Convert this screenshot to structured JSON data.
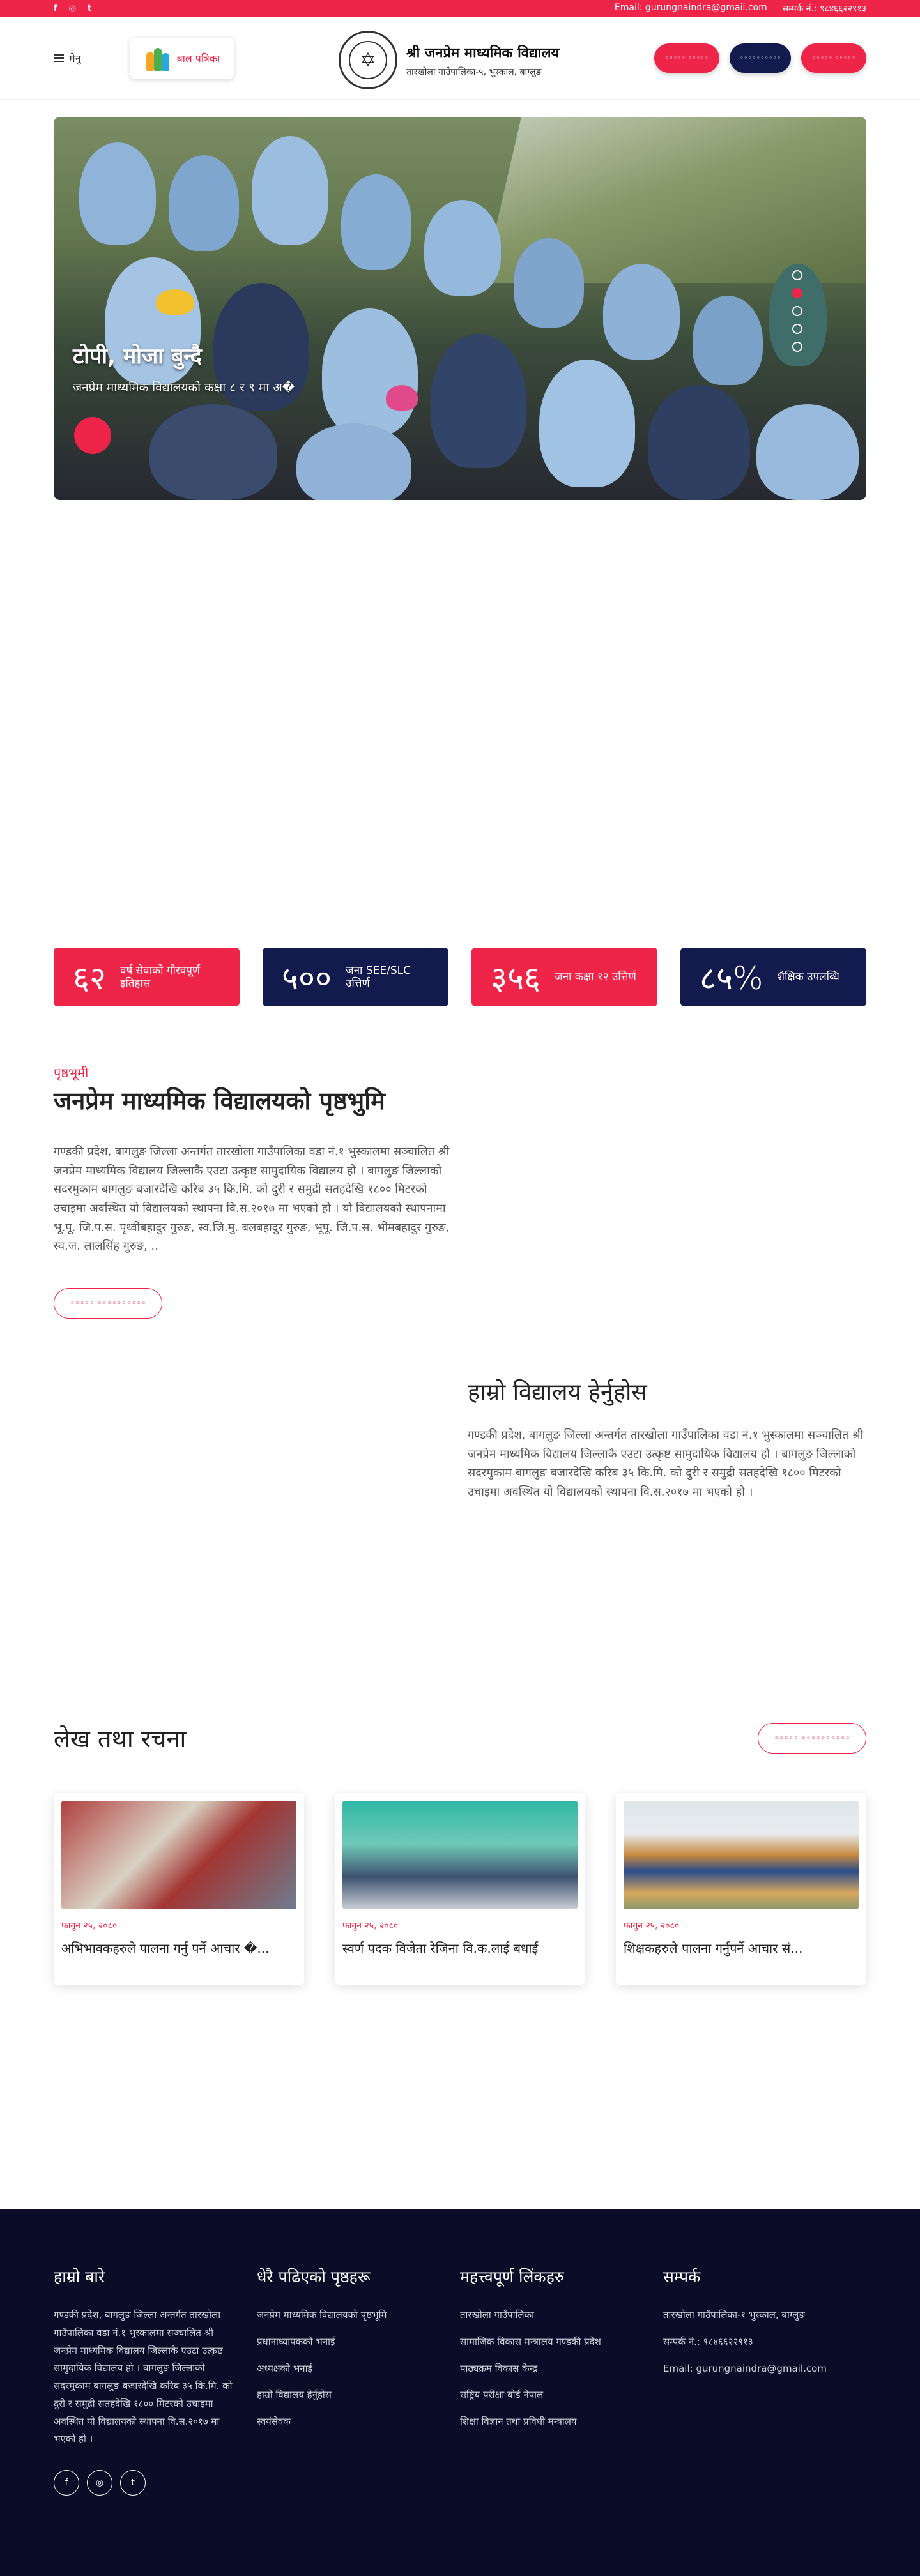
{
  "topbar": {
    "social": [
      "f",
      "◎",
      "t"
    ],
    "email": "Email: gurungnaindra@gmail.com",
    "phone": "सम्पर्क नं.: ९८४६६२२९१३"
  },
  "header": {
    "menu_label": "मेनु",
    "bal_label": "बाल पत्रिका",
    "school_name": "श्री जनप्रेम माध्यमिक विद्यालय",
    "school_address": "तारखोला गाउँपालिका-५, भुस्काल, बाग्लुङ",
    "buttons": [
      "◦◦◦◦◦ ◦◦◦◦◦",
      "◦◦◦◦◦◦◦◦◦◦",
      "◦◦◦◦◦ ◦◦◦◦◦"
    ]
  },
  "hero": {
    "title": "टोपी, मोजा बुन्दै",
    "subtitle": "जनप्रेम माध्यमिक विद्यालयको कक्षा ८ र ९ मा अ�",
    "slides": 5,
    "active_slide": 1
  },
  "stats": [
    {
      "num": "६२",
      "label": "वर्ष सेवाको गौरवपूर्ण इतिहास",
      "color": "red"
    },
    {
      "num": "५००",
      "label": "जना SEE/SLC उत्तिर्ण",
      "color": "navy"
    },
    {
      "num": "३५६",
      "label": "जना कक्षा १२ उत्तिर्ण",
      "color": "red"
    },
    {
      "num": "८५%",
      "label": "शैक्षिक उपलब्धि",
      "color": "navy"
    }
  ],
  "about": {
    "kicker": "पृष्ठभूमी",
    "title": "जनप्रेम माध्यमिक विद्यालयको पृष्ठभुमि",
    "text": "गण्डकी प्रदेश, बागलुङ जिल्ला अन्तर्गत तारखोला गाउँपालिका वडा नं.१ भुस्कालमा सञ्चालित श्री जनप्रेम माध्यमिक विद्यालय जिल्लाकै एउटा उत्कृष्ट सामुदायिक विद्यालय हो । बागलुङ जिल्लाको सदरमुकाम बागलुङ बजारदेखि करिब ३५ कि.मि. को दुरी र समुद्री सतहदेखि १८०० मिटरको उचाइमा अवस्थित यो विद्यालयको स्थापना वि.स.२०१७ मा भएको हो । यो विद्यालयको स्थापनामा भू.पू. जि.प.स. पृथ्वीबहादुर गुरुङ, स्व.जि.मु. बलबहादुर गुरुङ, भूपू. जि.प.स. भीमबहादुर गुरुङ, स्व.ज. लालसिंह गुरुङ, ..",
    "button": "◦◦◦◦◦ ◦◦◦◦◦◦◦◦◦◦"
  },
  "visit": {
    "title": "हाम्रो विद्यालय हेर्नुहोस",
    "text": "गण्डकी प्रदेश, बागलुङ जिल्ला अन्तर्गत तारखोला गाउँपालिका वडा नं.१ भुस्कालमा सञ्चालित श्री जनप्रेम माध्यमिक विद्यालय जिल्लाकै एउटा उत्कृष्ट सामुदायिक विद्यालय हो । बागलुङ जिल्लाको सदरमुकाम बागलुङ बजारदेखि करिब ३५ कि.मि. को दुरी र समुद्री सतहदेखि १८०० मिटरको उचाइमा अवस्थित यो विद्यालयको स्थापना वि.स.२०१७ मा भएको हो ।"
  },
  "articles": {
    "title": "लेख तथा रचना",
    "button": "◦◦◦◦◦ ◦◦◦◦◦◦◦◦◦◦",
    "items": [
      {
        "date": "फागुन २५, २०८०",
        "title": "अभिभावकहरुले पालना गर्नु पर्ने आचार �..."
      },
      {
        "date": "फागुन २५, २०८०",
        "title": "स्वर्ण पदक विजेता रेजिना वि.क.लाई बधाई"
      },
      {
        "date": "फागुन २५, २०८०",
        "title": "शिक्षकहरुले पालना गर्नुपर्ने आचार सं..."
      }
    ]
  },
  "footer": {
    "about_title": "हाम्रो बारे",
    "about_text": "गण्डकी प्रदेश, बागलुङ जिल्ला अन्तर्गत तारखोला गाउँपालिका वडा नं.१ भुस्कालमा सञ्चालित श्री जनप्रेम माध्यमिक विद्यालय जिल्लाकै एउटा उत्कृष्ट सामुदायिक विद्यालय हो । बागलुङ जिल्लाको सदरमुकाम बागलुङ बजारदेखि करिब ३५ कि.मि. को दुरी र समुद्री सतहदेखि १८०० मिटरको उचाइमा अवस्थित यो विद्यालयको स्थापना वि.स.२०१७ मा भएको हो ।",
    "pages_title": "धेरै पढिएको पृष्ठहरू",
    "pages": [
      "जनप्रेम माध्यमिक विद्यालयको पृष्ठभूमि",
      "प्रधानाध्यापकको भनाई",
      "अध्यक्षको भनाई",
      "हाम्रो विद्यालय हेर्नुहोस",
      "स्वयंसेवक"
    ],
    "links_title": "महत्त्वपूर्ण लिंकहरु",
    "links": [
      "तारखोला गाउँपालिका",
      "सामाजिक विकास मन्त्रालय गण्डकी प्रदेश",
      "पाठ्यक्रम विकास केन्द्र",
      "राष्ट्रिय परीक्षा बोर्ड नेपाल",
      "शिक्षा विज्ञान तथा प्रविधी मन्त्रालय"
    ],
    "contact_title": "सम्पर्क",
    "contact": [
      "तारखोला गाउँपालिका-१ भुस्काल, बाग्लुङ",
      "सम्पर्क नं.: ९८४६६२२९१३",
      "Email: gurungnaindra@gmail.com"
    ],
    "social": [
      "f",
      "◎",
      "t"
    ]
  },
  "colors": {
    "accent": "#ee2449",
    "navy": "#131a4e",
    "footer": "#0b0d28"
  }
}
